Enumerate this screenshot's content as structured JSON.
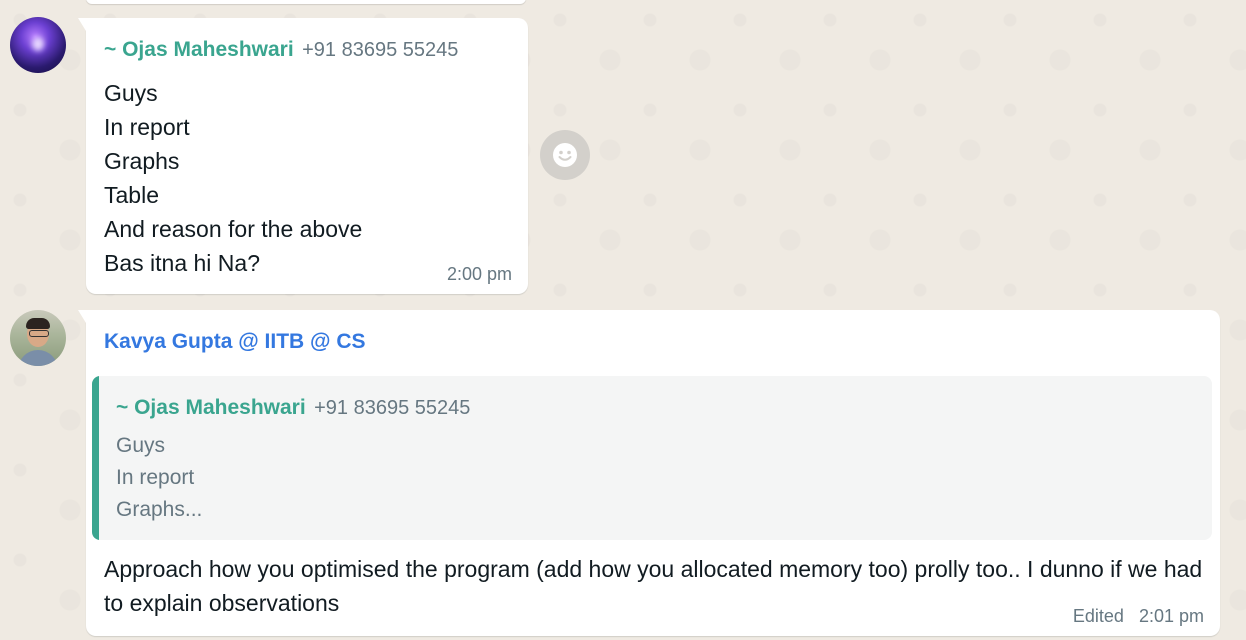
{
  "messages": [
    {
      "sender_name": "~ Ojas Maheshwari",
      "sender_phone": "+91 83695 55245",
      "lines": [
        "Guys",
        "In report",
        "Graphs",
        "Table",
        "And reason for the above",
        "Bas itna hi Na?"
      ],
      "time": "2:00 pm",
      "avatar_icon": "group-member-avatar"
    },
    {
      "sender_name": "Kavya Gupta @ IITB @ CS",
      "quoted": {
        "sender_name": "~ Ojas Maheshwari",
        "sender_phone": "+91 83695 55245",
        "lines": [
          "Guys",
          "In report",
          "Graphs..."
        ]
      },
      "text": "Approach how you optimised the program (add how you allocated memory too) prolly too.. I dunno if we had to explain observations",
      "edited_label": "Edited",
      "time": "2:01 pm",
      "avatar_icon": "profile-photo-avatar"
    }
  ],
  "reaction_button_icon": "smiley-icon",
  "colors": {
    "chat_background": "#efeae2",
    "bubble": "#ffffff",
    "sender_green": "#3aa58f",
    "sender_blue": "#3478e0",
    "meta_gray": "#667781"
  }
}
